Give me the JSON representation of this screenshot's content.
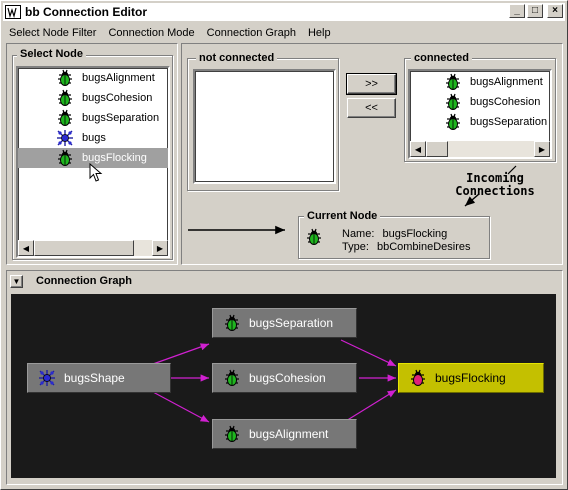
{
  "window": {
    "title": "bb Connection Editor",
    "minimize": "_",
    "maximize": "□",
    "close": "×"
  },
  "menu": [
    "Select Node Filter",
    "Connection Mode",
    "Connection Graph",
    "Help"
  ],
  "select_node": {
    "label": "Select Node",
    "items": [
      {
        "label": "bugsAlignment",
        "icon": "bug-icon"
      },
      {
        "label": "bugsCohesion",
        "icon": "bug-icon"
      },
      {
        "label": "bugsSeparation",
        "icon": "bug-icon"
      },
      {
        "label": "bugs",
        "icon": "bugs-shape-icon"
      },
      {
        "label": "bugsFlocking",
        "icon": "bug-icon",
        "selected": true
      }
    ]
  },
  "not_connected": {
    "label": "not connected"
  },
  "buttons": {
    "add": ">>",
    "remove": "<<"
  },
  "connected": {
    "label": "connected",
    "items": [
      "bugsAlignment",
      "bugsCohesion",
      "bugsSeparation"
    ]
  },
  "annotation": {
    "line1": "Incoming",
    "line2": "Connections"
  },
  "current_node": {
    "label": "Current Node",
    "name_label": "Name:",
    "name_value": "bugsFlocking",
    "type_label": "Type:",
    "type_value": "bbCombineDesires"
  },
  "graph": {
    "label": "Connection Graph",
    "collapse": "▼",
    "nodes": {
      "shape": "bugsShape",
      "separation": "bugsSeparation",
      "cohesion": "bugsCohesion",
      "alignment": "bugsAlignment",
      "flocking": "bugsFlocking"
    },
    "edge_color": "#d020d0",
    "current_color": "#c4c000"
  }
}
